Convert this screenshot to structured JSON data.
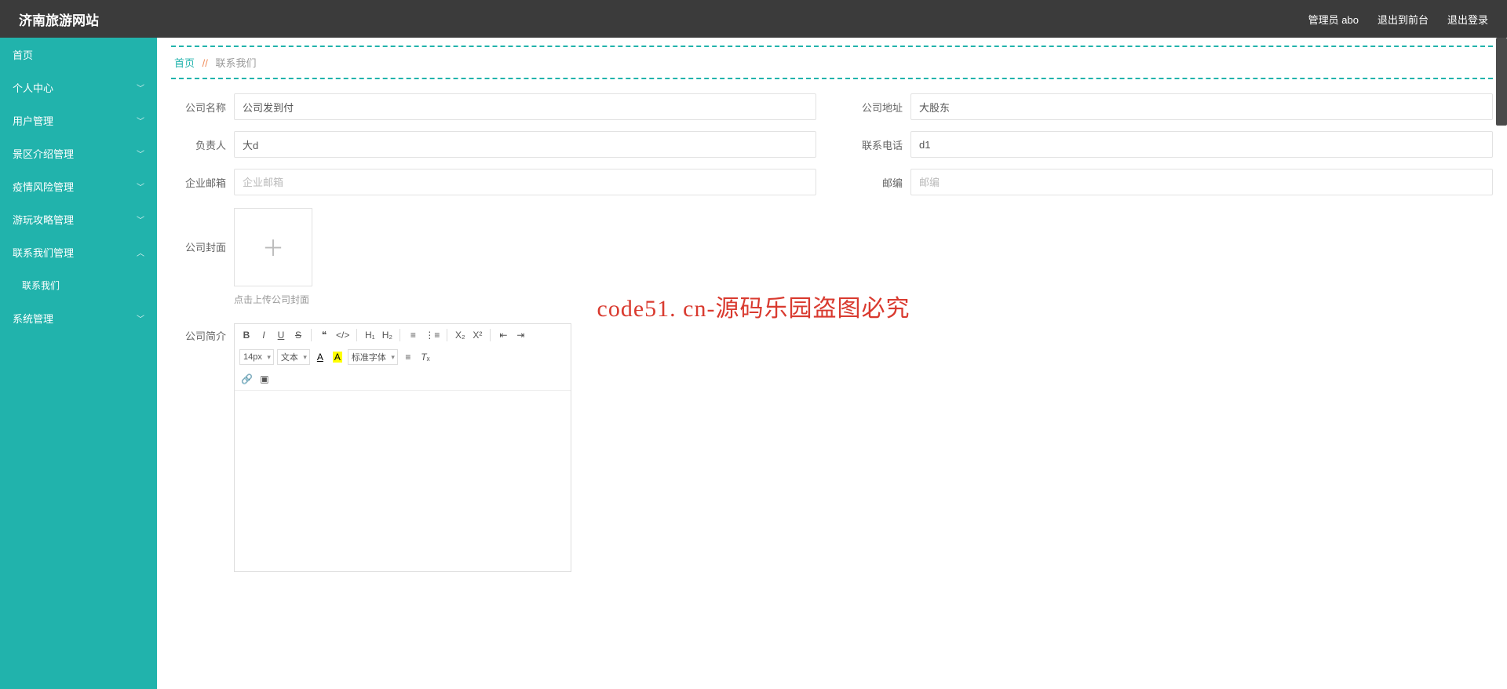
{
  "watermark_text": "code51.cn",
  "overlay_text": "code51. cn-源码乐园盗图必究",
  "header": {
    "brand": "济南旅游网站",
    "admin_label": "管理员 abo",
    "to_front_label": "退出到前台",
    "logout_label": "退出登录"
  },
  "sidebar": {
    "items": [
      {
        "label": "首页",
        "expandable": false
      },
      {
        "label": "个人中心",
        "expandable": true,
        "chevron": "down"
      },
      {
        "label": "用户管理",
        "expandable": true,
        "chevron": "down"
      },
      {
        "label": "景区介绍管理",
        "expandable": true,
        "chevron": "down"
      },
      {
        "label": "疫情风险管理",
        "expandable": true,
        "chevron": "down"
      },
      {
        "label": "游玩攻略管理",
        "expandable": true,
        "chevron": "down"
      },
      {
        "label": "联系我们管理",
        "expandable": true,
        "chevron": "up"
      },
      {
        "label": "系统管理",
        "expandable": true,
        "chevron": "down"
      }
    ],
    "sub_item": "联系我们"
  },
  "breadcrumb": {
    "home": "首页",
    "sep": "//",
    "current": "联系我们"
  },
  "form": {
    "company_name": {
      "label": "公司名称",
      "value": "公司发到付"
    },
    "company_addr": {
      "label": "公司地址",
      "value": "大股东"
    },
    "principal": {
      "label": "负责人",
      "value": "大d"
    },
    "phone": {
      "label": "联系电话",
      "value": "d1"
    },
    "email": {
      "label": "企业邮箱",
      "value": "",
      "placeholder": "企业邮箱"
    },
    "postcode": {
      "label": "邮编",
      "value": "",
      "placeholder": "邮编"
    },
    "cover": {
      "label": "公司封面",
      "hint": "点击上传公司封面"
    },
    "intro": {
      "label": "公司简介"
    }
  },
  "editor": {
    "font_size": "14px",
    "para": "文本",
    "font_family": "标准字体"
  }
}
